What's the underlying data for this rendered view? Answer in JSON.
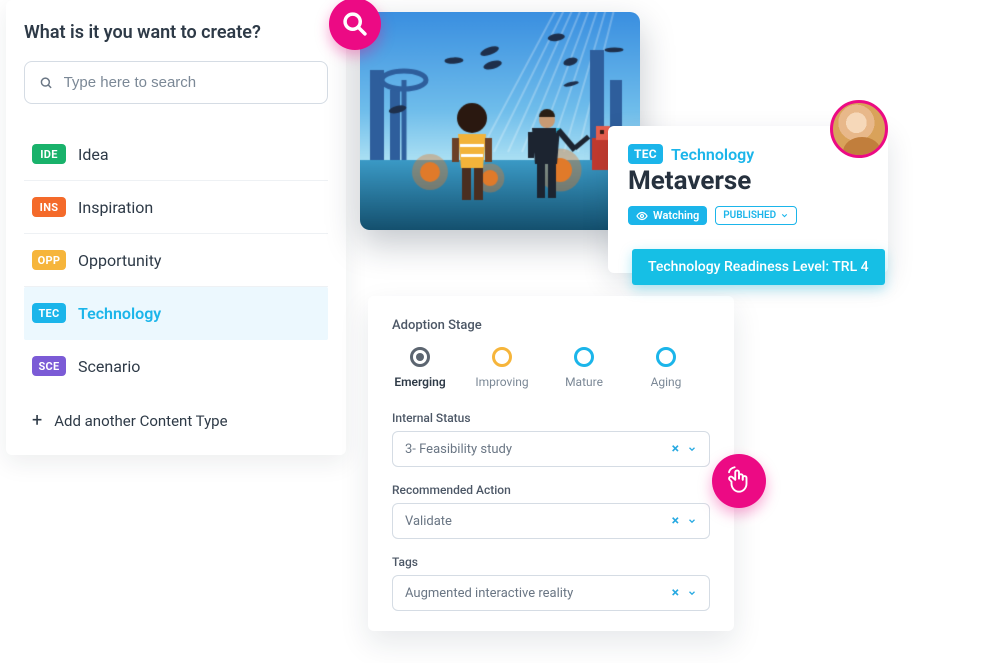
{
  "sidebar": {
    "title": "What is it you want to create?",
    "search_placeholder": "Type here to search",
    "types": [
      {
        "badge": "IDE",
        "label": "Idea"
      },
      {
        "badge": "INS",
        "label": "Inspiration"
      },
      {
        "badge": "OPP",
        "label": "Opportunity"
      },
      {
        "badge": "TEC",
        "label": "Technology",
        "selected": true
      },
      {
        "badge": "SCE",
        "label": "Scenario"
      }
    ],
    "add_label": "Add another Content Type"
  },
  "detail": {
    "type_badge": "TEC",
    "type_label": "Technology",
    "title": "Metaverse",
    "watching_label": "Watching",
    "publish_label": "PUBLISHED",
    "trl_label": "Technology Readiness Level: TRL 4"
  },
  "form": {
    "adoption_label": "Adoption Stage",
    "stages": [
      "Emerging",
      "Improving",
      "Mature",
      "Aging"
    ],
    "fields": {
      "internal_status": {
        "label": "Internal Status",
        "value": "3- Feasibility study"
      },
      "recommended_action": {
        "label": "Recommended Action",
        "value": "Validate"
      },
      "tags": {
        "label": "Tags",
        "value": "Augmented interactive reality"
      }
    }
  }
}
